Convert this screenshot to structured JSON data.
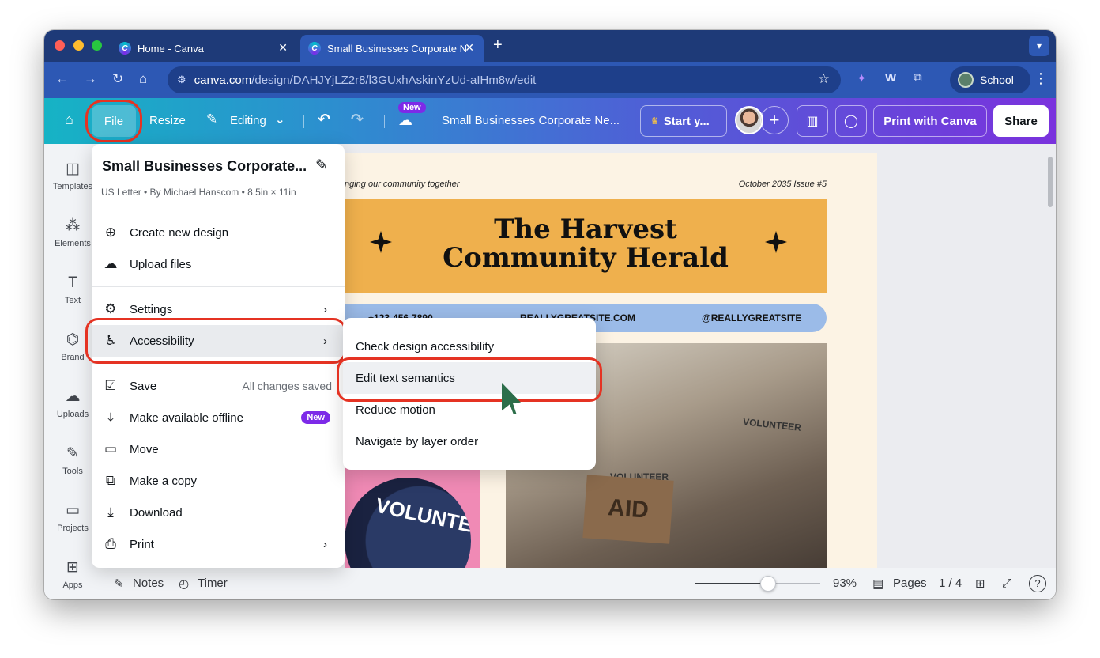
{
  "browser": {
    "tabs": [
      {
        "title": "Home - Canva",
        "close": "✕"
      },
      {
        "title": "Small Businesses Corporate N",
        "close": "✕"
      }
    ],
    "new_tab": "+",
    "url_host": "canva.com",
    "url_path": "/design/DAHJYjLZ2r8/l3GUxhAskinYzUd-aIHm8w/edit",
    "profile_name": "School",
    "icons": {
      "back": "arrow-left",
      "forward": "arrow-right",
      "reload": "reload",
      "home": "home",
      "bookmark": "star",
      "extensions": "puzzle"
    }
  },
  "canva_header": {
    "file": "File",
    "resize": "Resize",
    "editing": "Editing",
    "new_badge": "New",
    "doc_title": "Small Businesses Corporate Ne...",
    "start": "Start y...",
    "print": "Print with Canva",
    "share": "Share",
    "colors": {
      "gradient_start": "#16b3c5",
      "gradient_end": "#7a32dd",
      "accent": "#7d2ae8"
    }
  },
  "rail": [
    {
      "label": "Templates",
      "icon": "templates-icon"
    },
    {
      "label": "Elements",
      "icon": "elements-icon"
    },
    {
      "label": "Text",
      "icon": "text-icon"
    },
    {
      "label": "Brand",
      "icon": "brand-icon"
    },
    {
      "label": "Uploads",
      "icon": "uploads-icon"
    },
    {
      "label": "Tools",
      "icon": "tools-icon"
    },
    {
      "label": "Projects",
      "icon": "projects-icon"
    },
    {
      "label": "Apps",
      "icon": "apps-icon"
    }
  ],
  "file_menu": {
    "title": "Small Businesses Corporate...",
    "subtitle": "US Letter • By Michael Hanscom • 8.5in × 11in",
    "items": [
      {
        "label": "Create new design"
      },
      {
        "label": "Upload files"
      },
      {
        "label": "Settings"
      },
      {
        "label": "Accessibility"
      },
      {
        "label": "Save",
        "note": "All changes saved"
      },
      {
        "label": "Make available offline",
        "badge": "New"
      },
      {
        "label": "Move"
      },
      {
        "label": "Make a copy"
      },
      {
        "label": "Download"
      },
      {
        "label": "Print"
      }
    ]
  },
  "accessibility_submenu": {
    "items": [
      {
        "label": "Check design accessibility"
      },
      {
        "label": "Edit text semantics"
      },
      {
        "label": "Reduce motion"
      },
      {
        "label": "Navigate by layer order"
      }
    ]
  },
  "newsletter": {
    "tagline": "nging our community together",
    "issue": "October 2035 Issue #5",
    "title_line1": "The Harvest",
    "title_line2": "Community Herald",
    "phone": "+123-456-7890",
    "site": "REALLYGREATSITE.COM",
    "handle": "@REALLYGREATSITE",
    "box_text": "AID",
    "shirt_1": "VOLUNTEER",
    "shirt_2": "VOLUNTEER",
    "circle_text": "VOLUNTEER"
  },
  "footer": {
    "notes": "Notes",
    "timer": "Timer",
    "zoom": "93%",
    "zoom_fraction": 0.58,
    "pages": "Pages",
    "page_count": "1 / 4"
  }
}
